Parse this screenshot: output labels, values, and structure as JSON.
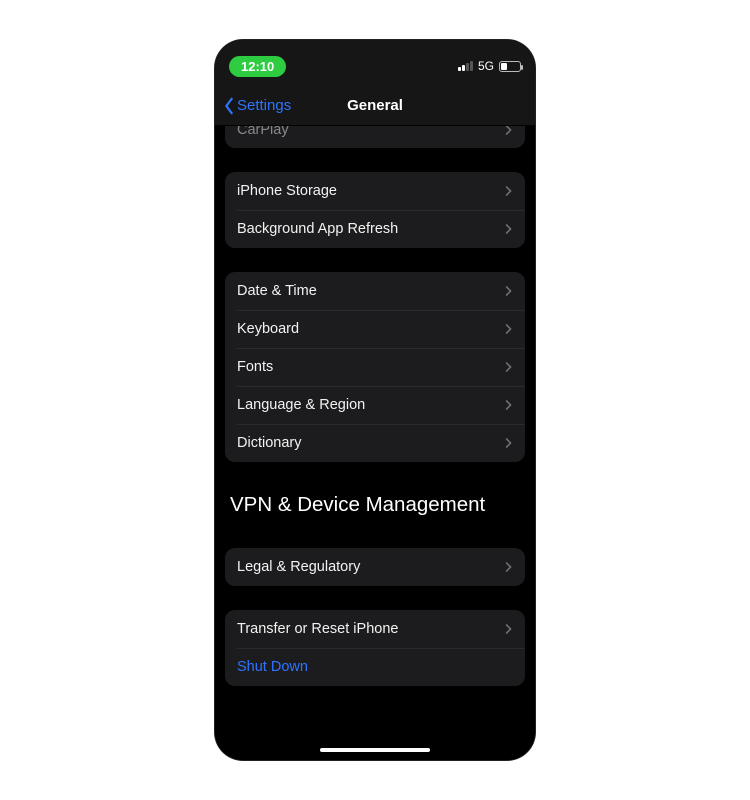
{
  "status": {
    "time": "12:10",
    "network": "5G"
  },
  "nav": {
    "back": "Settings",
    "title": "General"
  },
  "groups": {
    "g0": {
      "carplay": "CarPlay"
    },
    "g1": {
      "storage": "iPhone Storage",
      "bg_refresh": "Background App Refresh"
    },
    "g2": {
      "date_time": "Date & Time",
      "keyboard": "Keyboard",
      "fonts": "Fonts",
      "lang_region": "Language & Region",
      "dictionary": "Dictionary"
    },
    "g3": {
      "vpn": "VPN & Device Management"
    },
    "g4": {
      "legal": "Legal & Regulatory"
    },
    "g5": {
      "transfer_reset": "Transfer or Reset iPhone",
      "shutdown": "Shut Down"
    }
  }
}
